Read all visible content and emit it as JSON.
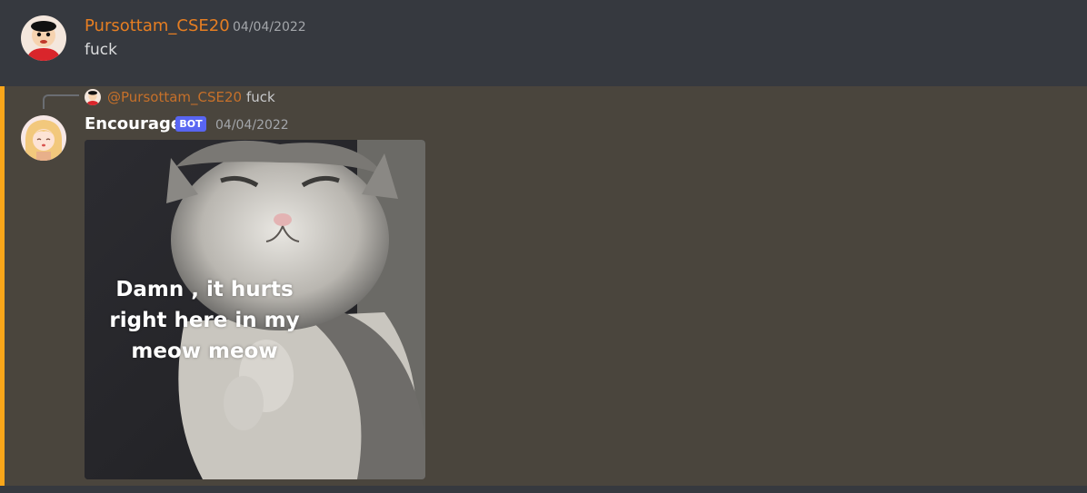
{
  "messages": [
    {
      "author": "Pursottam_CSE20",
      "timestamp": "04/04/2022",
      "content": "fuck",
      "author_color": "#e67e22"
    },
    {
      "author": "Encourager",
      "bot_tag": "BOT",
      "timestamp": "04/04/2022",
      "reply": {
        "mention": "@Pursottam_CSE20",
        "text": "fuck"
      },
      "attachment": {
        "caption": "Damn , it hurts right here in my meow meow"
      },
      "mention_highlight_color": "#faa61a"
    }
  ]
}
